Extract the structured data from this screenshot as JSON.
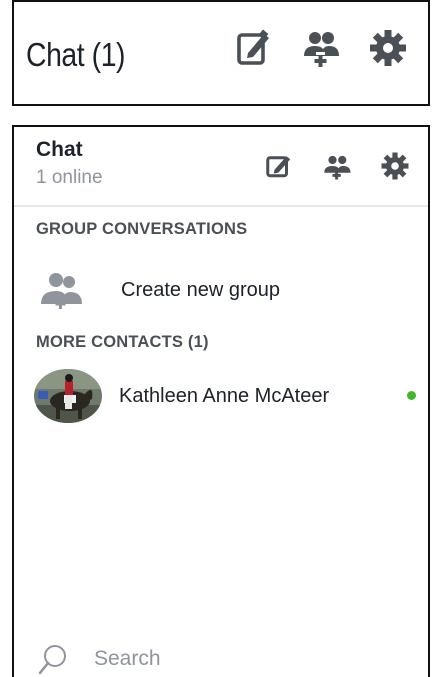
{
  "collapsed_bar": {
    "title": "Chat (1)",
    "icons": [
      "compose-icon",
      "add-people-icon",
      "gear-icon"
    ]
  },
  "panel": {
    "header": {
      "title": "Chat",
      "subtitle": "1 online",
      "icons": [
        "compose-icon",
        "add-people-icon",
        "gear-icon"
      ]
    },
    "group_section": {
      "label": "GROUP CONVERSATIONS",
      "create_group_label": "Create new group"
    },
    "contacts_section": {
      "label": "MORE CONTACTS (1)",
      "contacts": [
        {
          "name": "Kathleen Anne McAteer",
          "status": "online",
          "status_color": "#42b72a"
        }
      ]
    },
    "search": {
      "placeholder": "Search",
      "value": ""
    }
  },
  "colors": {
    "icon_dark": "#4b4f56",
    "icon_muted": "#90949c",
    "online": "#42b72a",
    "border": "#111111",
    "divider": "#e4e6eb"
  }
}
